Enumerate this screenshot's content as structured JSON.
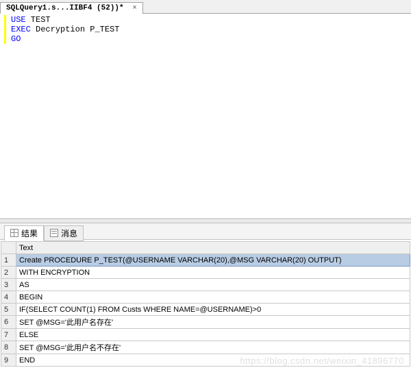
{
  "tab": {
    "title": "SQLQuery1.s...IIBF4 (52))*"
  },
  "code": {
    "lines": [
      {
        "kw": "USE",
        "rest": " TEST"
      },
      {
        "kw": "EXEC",
        "rest": " Decryption P_TEST"
      },
      {
        "kw": "GO",
        "rest": ""
      }
    ]
  },
  "results_tabs": {
    "results_label": "结果",
    "messages_label": "消息"
  },
  "grid": {
    "header": "Text",
    "rows": [
      "Create PROCEDURE P_TEST(@USERNAME VARCHAR(20),@MSG VARCHAR(20) OUTPUT)",
      "WITH ENCRYPTION",
      "AS",
      "BEGIN",
      "  IF(SELECT COUNT(1) FROM Custs WHERE NAME=@USERNAME)>0",
      "    SET @MSG='此用户名存在'",
      "  ELSE",
      "    SET @MSG='此用户名不存在'",
      "  END"
    ]
  },
  "watermark": "https://blog.csdn.net/weixin_41896770"
}
